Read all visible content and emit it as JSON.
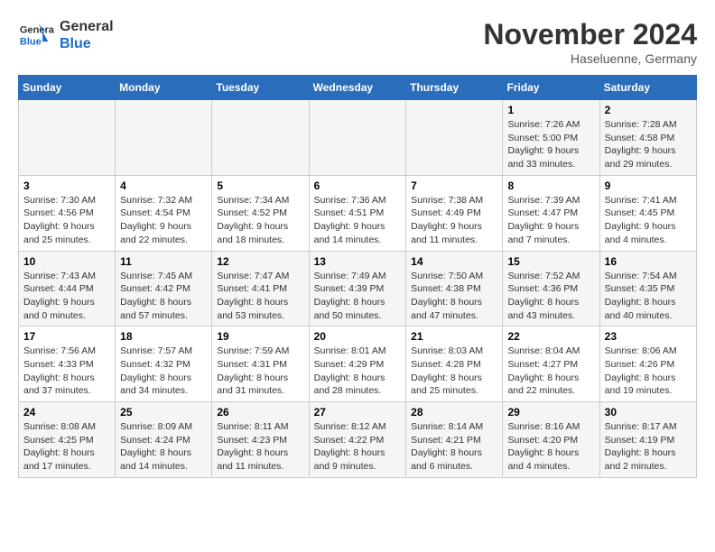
{
  "logo": {
    "line1": "General",
    "line2": "Blue"
  },
  "title": "November 2024",
  "location": "Haseluenne, Germany",
  "days_of_week": [
    "Sunday",
    "Monday",
    "Tuesday",
    "Wednesday",
    "Thursday",
    "Friday",
    "Saturday"
  ],
  "weeks": [
    [
      {
        "day": "",
        "info": ""
      },
      {
        "day": "",
        "info": ""
      },
      {
        "day": "",
        "info": ""
      },
      {
        "day": "",
        "info": ""
      },
      {
        "day": "",
        "info": ""
      },
      {
        "day": "1",
        "info": "Sunrise: 7:26 AM\nSunset: 5:00 PM\nDaylight: 9 hours and 33 minutes."
      },
      {
        "day": "2",
        "info": "Sunrise: 7:28 AM\nSunset: 4:58 PM\nDaylight: 9 hours and 29 minutes."
      }
    ],
    [
      {
        "day": "3",
        "info": "Sunrise: 7:30 AM\nSunset: 4:56 PM\nDaylight: 9 hours and 25 minutes."
      },
      {
        "day": "4",
        "info": "Sunrise: 7:32 AM\nSunset: 4:54 PM\nDaylight: 9 hours and 22 minutes."
      },
      {
        "day": "5",
        "info": "Sunrise: 7:34 AM\nSunset: 4:52 PM\nDaylight: 9 hours and 18 minutes."
      },
      {
        "day": "6",
        "info": "Sunrise: 7:36 AM\nSunset: 4:51 PM\nDaylight: 9 hours and 14 minutes."
      },
      {
        "day": "7",
        "info": "Sunrise: 7:38 AM\nSunset: 4:49 PM\nDaylight: 9 hours and 11 minutes."
      },
      {
        "day": "8",
        "info": "Sunrise: 7:39 AM\nSunset: 4:47 PM\nDaylight: 9 hours and 7 minutes."
      },
      {
        "day": "9",
        "info": "Sunrise: 7:41 AM\nSunset: 4:45 PM\nDaylight: 9 hours and 4 minutes."
      }
    ],
    [
      {
        "day": "10",
        "info": "Sunrise: 7:43 AM\nSunset: 4:44 PM\nDaylight: 9 hours and 0 minutes."
      },
      {
        "day": "11",
        "info": "Sunrise: 7:45 AM\nSunset: 4:42 PM\nDaylight: 8 hours and 57 minutes."
      },
      {
        "day": "12",
        "info": "Sunrise: 7:47 AM\nSunset: 4:41 PM\nDaylight: 8 hours and 53 minutes."
      },
      {
        "day": "13",
        "info": "Sunrise: 7:49 AM\nSunset: 4:39 PM\nDaylight: 8 hours and 50 minutes."
      },
      {
        "day": "14",
        "info": "Sunrise: 7:50 AM\nSunset: 4:38 PM\nDaylight: 8 hours and 47 minutes."
      },
      {
        "day": "15",
        "info": "Sunrise: 7:52 AM\nSunset: 4:36 PM\nDaylight: 8 hours and 43 minutes."
      },
      {
        "day": "16",
        "info": "Sunrise: 7:54 AM\nSunset: 4:35 PM\nDaylight: 8 hours and 40 minutes."
      }
    ],
    [
      {
        "day": "17",
        "info": "Sunrise: 7:56 AM\nSunset: 4:33 PM\nDaylight: 8 hours and 37 minutes."
      },
      {
        "day": "18",
        "info": "Sunrise: 7:57 AM\nSunset: 4:32 PM\nDaylight: 8 hours and 34 minutes."
      },
      {
        "day": "19",
        "info": "Sunrise: 7:59 AM\nSunset: 4:31 PM\nDaylight: 8 hours and 31 minutes."
      },
      {
        "day": "20",
        "info": "Sunrise: 8:01 AM\nSunset: 4:29 PM\nDaylight: 8 hours and 28 minutes."
      },
      {
        "day": "21",
        "info": "Sunrise: 8:03 AM\nSunset: 4:28 PM\nDaylight: 8 hours and 25 minutes."
      },
      {
        "day": "22",
        "info": "Sunrise: 8:04 AM\nSunset: 4:27 PM\nDaylight: 8 hours and 22 minutes."
      },
      {
        "day": "23",
        "info": "Sunrise: 8:06 AM\nSunset: 4:26 PM\nDaylight: 8 hours and 19 minutes."
      }
    ],
    [
      {
        "day": "24",
        "info": "Sunrise: 8:08 AM\nSunset: 4:25 PM\nDaylight: 8 hours and 17 minutes."
      },
      {
        "day": "25",
        "info": "Sunrise: 8:09 AM\nSunset: 4:24 PM\nDaylight: 8 hours and 14 minutes."
      },
      {
        "day": "26",
        "info": "Sunrise: 8:11 AM\nSunset: 4:23 PM\nDaylight: 8 hours and 11 minutes."
      },
      {
        "day": "27",
        "info": "Sunrise: 8:12 AM\nSunset: 4:22 PM\nDaylight: 8 hours and 9 minutes."
      },
      {
        "day": "28",
        "info": "Sunrise: 8:14 AM\nSunset: 4:21 PM\nDaylight: 8 hours and 6 minutes."
      },
      {
        "day": "29",
        "info": "Sunrise: 8:16 AM\nSunset: 4:20 PM\nDaylight: 8 hours and 4 minutes."
      },
      {
        "day": "30",
        "info": "Sunrise: 8:17 AM\nSunset: 4:19 PM\nDaylight: 8 hours and 2 minutes."
      }
    ]
  ]
}
